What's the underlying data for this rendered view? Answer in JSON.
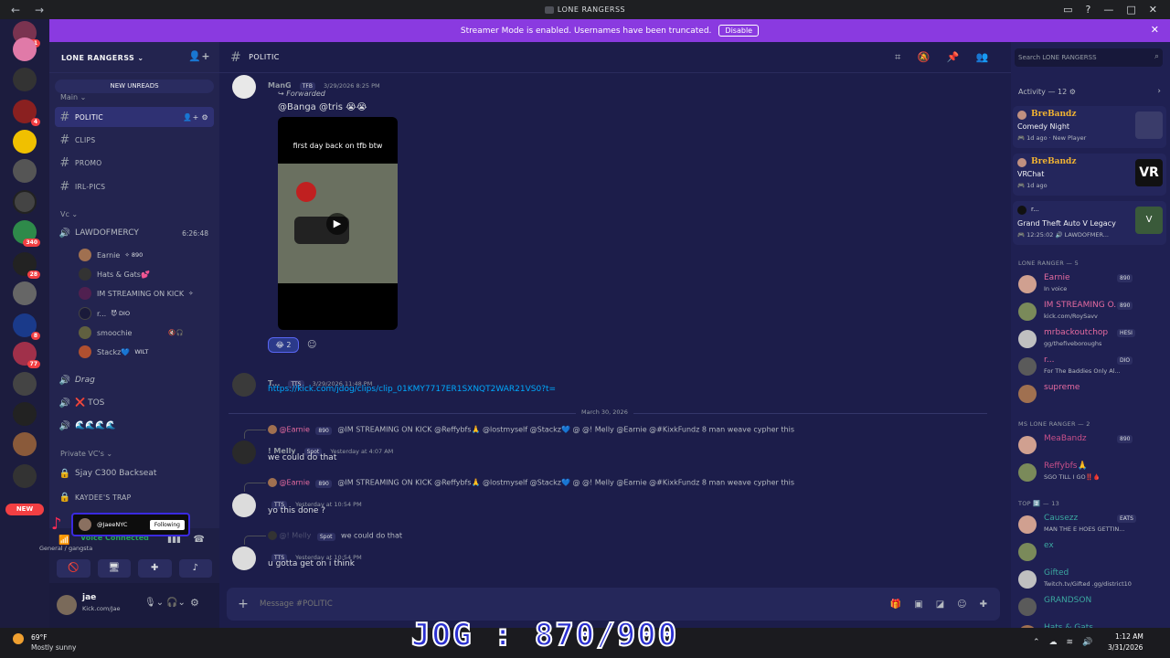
{
  "window": {
    "title": "LONE RANGERSS",
    "back_glyph": "←",
    "fwd_glyph": "→"
  },
  "banner": {
    "text": "Streamer Mode is enabled. Usernames have been truncated.",
    "button": "Disable"
  },
  "rail": {
    "badges": [
      "91",
      "4",
      "340",
      "28",
      "8",
      "77"
    ],
    "new_label": "NEW"
  },
  "sidebar": {
    "server_name": "LONE RANGERSS ⌄",
    "new_unreads": "NEW UNREADS",
    "category_main": "Main ⌄",
    "channels": [
      "POLITIC",
      "CLIPS",
      "PROMO",
      "IRL-PICS"
    ],
    "category_vc": "Vc ⌄",
    "voice_channel": "LAWDOFMERCY",
    "voice_timer": "6:26:48",
    "voice_users": [
      {
        "name": "Earnie",
        "tag": "✧ 890"
      },
      {
        "name": "Hats & Gats💕",
        "tag": ""
      },
      {
        "name": "IM STREAMING ON KICK",
        "tag": "✧"
      },
      {
        "name": "r...",
        "tag": "😈 DIO"
      },
      {
        "name": "smoochie",
        "tag": ""
      },
      {
        "name": "Stackz💙",
        "tag": "WILT"
      }
    ],
    "voice2": "Drag",
    "voice3": "❌ TOS",
    "voice4": "🌊🌊🌊🌊",
    "category_private": "Private VC's ⌄",
    "private1": "Sjay C300 Backseat",
    "private2": "KAYDEE'S TRAP",
    "vc_status": "Voice Connected",
    "vc_sub": "General / gangsta",
    "follow_name": "@JaeeNYC",
    "follow_btn": "Following",
    "user_name": "jae",
    "user_status": "Kick.com/Jae"
  },
  "chat": {
    "channel": "POLITIC",
    "messages": [
      {
        "name": "ManG",
        "tag": "TFB",
        "time": "3/29/2026 8:25 PM",
        "forwarded": "Forwarded",
        "text": "@Banga @tris 😭😭"
      },
      {
        "name": "T...",
        "tag": "TTS",
        "time": "3/29/2026 11:48 PM",
        "text": "https://kick.com/jdog/clips/clip_01KMY7717ER1SXNQT2WAR21VS0?t="
      },
      {
        "reply_name": "@Earnie",
        "reply_tag": "890",
        "reply_text": "@IM STREAMING ON KICK @Reffybfs🙏 @lostmyself @Stackz💙 @ @! Melly @Earnie @#KixkFundz 8 man weave cypher this",
        "name": "! Melly",
        "tag": "Spot",
        "time": "Yesterday at 4:07 AM",
        "text": "we could do that"
      },
      {
        "reply_name": "@Earnie",
        "reply_tag": "890",
        "reply_text": "@IM STREAMING ON KICK @Reffybfs🙏 @lostmyself @Stackz💙 @ @! Melly @Earnie @#KixkFundz 8 man weave cypher this",
        "name": "",
        "tag": "TTS",
        "time": "Yesterday at 10:54 PM",
        "text": "yo this done ?"
      },
      {
        "reply_name": "@! Melly",
        "reply_tag": "Spot",
        "reply_text": "we could do that",
        "name": "",
        "tag": "TTS",
        "time": "Yesterday at 10:54 PM",
        "text": "u gotta get on i think"
      }
    ],
    "video_caption": "first day back on tfb btw",
    "reaction_count": "2",
    "date_divider": "March 30, 2026",
    "composer_placeholder": "Message #POLITIC"
  },
  "right": {
    "search_placeholder": "Search LONE RANGERSS",
    "activity_header": "Activity — 12",
    "activities": [
      {
        "name": "BreBandz",
        "game": "Comedy Night",
        "time": "1d ago",
        "extra": "New Player"
      },
      {
        "name": "BreBandz",
        "game": "VRChat",
        "time": "1d ago",
        "extra": ""
      },
      {
        "name": "r...",
        "game": "Grand Theft Auto V Legacy",
        "time": "12:25:02",
        "extra": "LAWDOFMER..."
      }
    ],
    "group1": "LONE RANGER — 5",
    "members1": [
      {
        "name": "Earnie",
        "tag": "890",
        "status": "In voice",
        "color": "#e66ba0"
      },
      {
        "name": "IM STREAMING O...",
        "tag": "890",
        "status": "kick.com/RoySavv",
        "color": "#e66ba0"
      },
      {
        "name": "mrbackoutchop",
        "tag": "HESI",
        "status": "gg/thefiveboroughs",
        "color": "#e66ba0"
      },
      {
        "name": "r...",
        "tag": "DIO",
        "status": "For The Baddies Only Al...",
        "color": "#e66ba0"
      },
      {
        "name": "supreme",
        "tag": "",
        "status": "",
        "color": "#e66ba0"
      }
    ],
    "group2": "MS LONE RANGER — 2",
    "members2": [
      {
        "name": "MeaBandz",
        "tag": "890",
        "status": "",
        "color": "#c9508a"
      },
      {
        "name": "Reffybfs🙏",
        "tag": "",
        "status": "SGO TILL I GO‼️🩸",
        "color": "#c9508a"
      }
    ],
    "group3": "TOP 2️⃣ — 13",
    "members3": [
      {
        "name": "Causezz",
        "tag": "EATS",
        "status": "MAN THE E HOES GETTIN...",
        "color": "#3ba7a0"
      },
      {
        "name": "ex",
        "tag": "",
        "status": "",
        "color": "#3ba7a0"
      },
      {
        "name": "Gifted",
        "tag": "",
        "status": "Twitch.tv/Gifted .gg/district10",
        "color": "#3ba7a0"
      },
      {
        "name": "GRANDSON",
        "tag": "",
        "status": "",
        "color": "#3ba7a0"
      },
      {
        "name": "Hats & Gats",
        "tag": "",
        "status": "",
        "color": "#3ba7a0"
      }
    ]
  },
  "taskbar": {
    "temp": "69°F",
    "weather": "Mostly sunny",
    "time": "1:12 AM",
    "date": "3/31/2026",
    "overlay": "JOG : 870/900"
  }
}
